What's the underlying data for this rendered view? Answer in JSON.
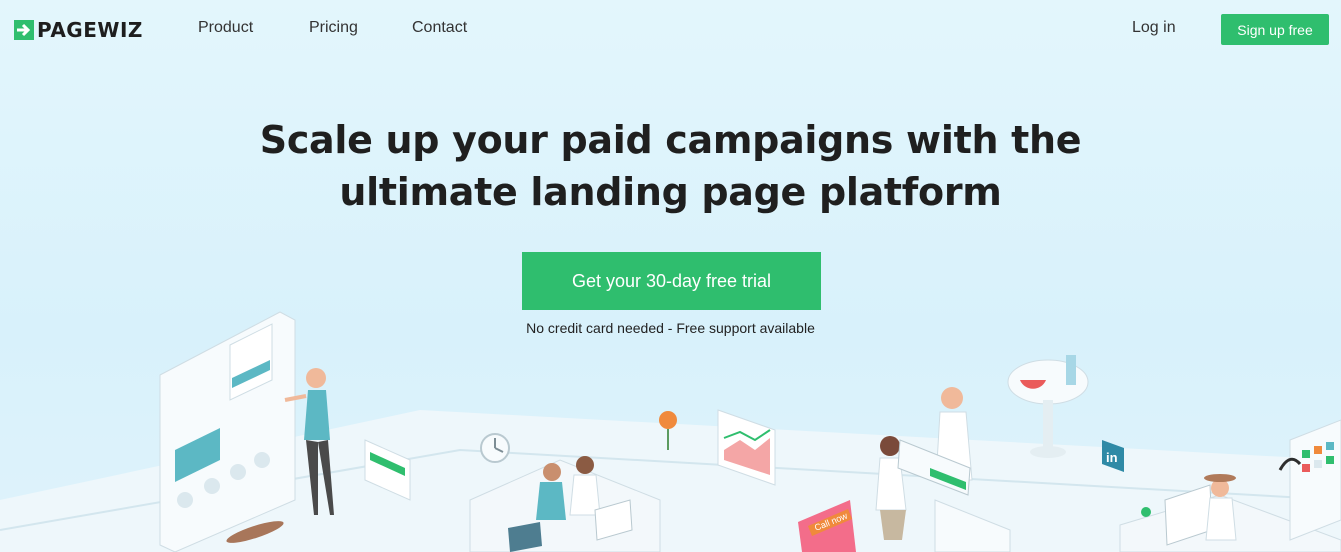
{
  "brand": {
    "name": "PAGEWIZ",
    "accent": "#2fbe6e"
  },
  "nav": {
    "items": [
      {
        "label": "Product"
      },
      {
        "label": "Pricing"
      },
      {
        "label": "Contact"
      }
    ],
    "login_label": "Log in",
    "signup_label": "Sign up free"
  },
  "hero": {
    "headline_line1": "Scale up your paid campaigns with the",
    "headline_line2": "ultimate landing page platform",
    "cta_label": "Get your 30-day free trial",
    "note": "No credit card needed - Free support available"
  },
  "illustration": {
    "call_badge": "Call now"
  }
}
